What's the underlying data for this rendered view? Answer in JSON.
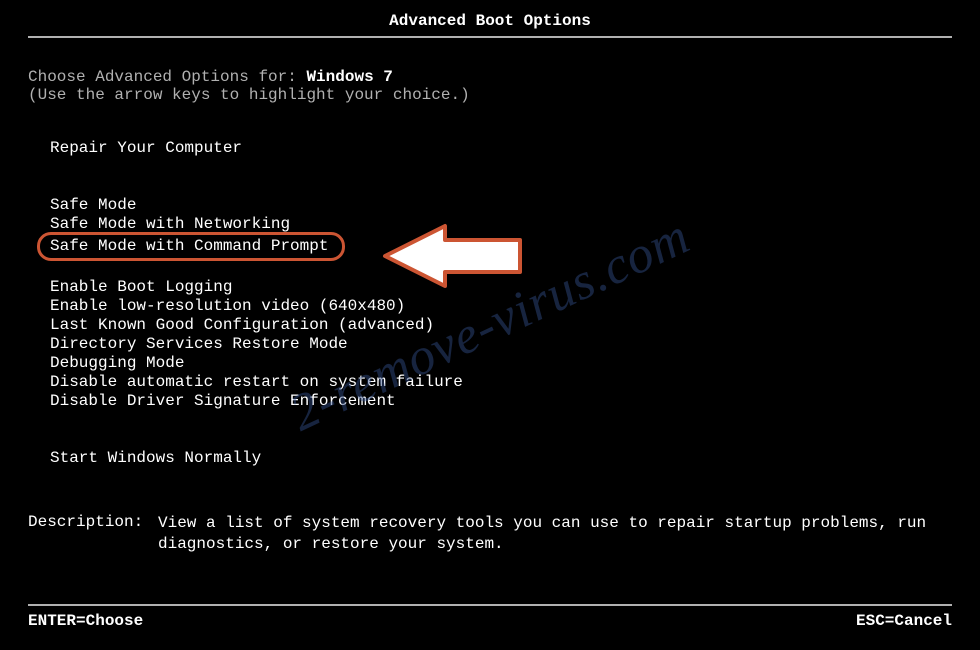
{
  "title": "Advanced Boot Options",
  "instruction": {
    "prefix": "Choose Advanced Options for: ",
    "os": "Windows 7",
    "hint": "(Use the arrow keys to highlight your choice.)"
  },
  "options_group1": [
    "Repair Your Computer"
  ],
  "options_group2": [
    "Safe Mode",
    "Safe Mode with Networking",
    "Safe Mode with Command Prompt"
  ],
  "options_group3": [
    "Enable Boot Logging",
    "Enable low-resolution video (640x480)",
    "Last Known Good Configuration (advanced)",
    "Directory Services Restore Mode",
    "Debugging Mode",
    "Disable automatic restart on system failure",
    "Disable Driver Signature Enforcement"
  ],
  "options_group4": [
    "Start Windows Normally"
  ],
  "highlighted_option_index_group2": 2,
  "description": {
    "label": "Description:",
    "text": "View a list of system recovery tools you can use to repair startup problems, run diagnostics, or restore your system."
  },
  "footer": {
    "enter": "ENTER=Choose",
    "esc": "ESC=Cancel"
  },
  "watermark": "2-remove-virus.com"
}
